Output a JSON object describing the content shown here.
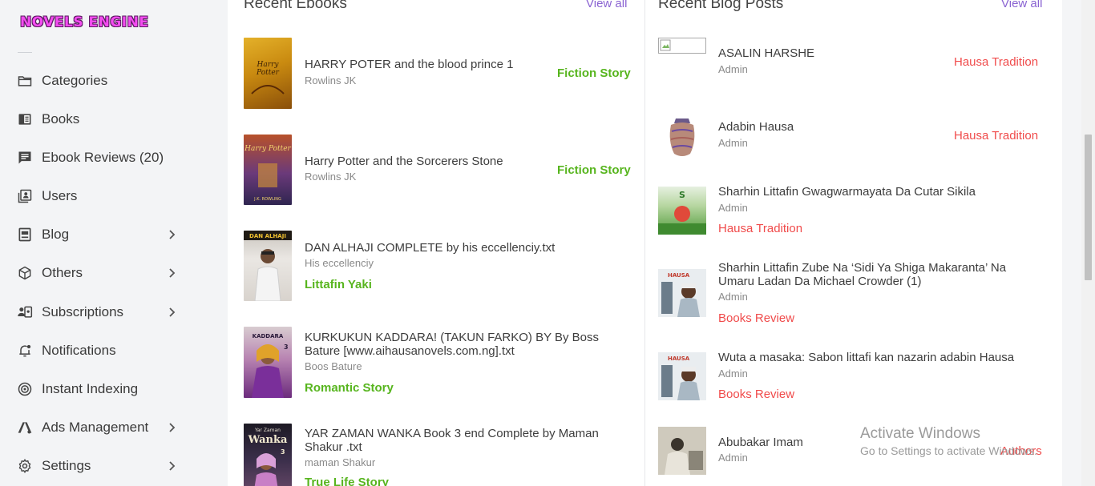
{
  "app": {
    "logo_text": "NOVELS ENGINE"
  },
  "sidebar": {
    "items": [
      {
        "label": "Categories",
        "icon": "folder-icon",
        "has_chevron": false
      },
      {
        "label": "Books",
        "icon": "book-icon",
        "has_chevron": false
      },
      {
        "label": "Ebook Reviews (20)",
        "icon": "review-icon",
        "has_chevron": false
      },
      {
        "label": "Users",
        "icon": "users-icon",
        "has_chevron": false
      },
      {
        "label": "Blog",
        "icon": "blog-icon",
        "has_chevron": true
      },
      {
        "label": "Others",
        "icon": "cube-icon",
        "has_chevron": true
      },
      {
        "label": "Subscriptions",
        "icon": "subscriptions-icon",
        "has_chevron": true
      },
      {
        "label": "Notifications",
        "icon": "bell-icon",
        "has_chevron": false
      },
      {
        "label": "Instant Indexing",
        "icon": "indexing-icon",
        "has_chevron": false
      },
      {
        "label": "Ads Management",
        "icon": "ads-icon",
        "has_chevron": true
      },
      {
        "label": "Settings",
        "icon": "gear-icon",
        "has_chevron": true
      }
    ]
  },
  "ebooks": {
    "title": "Recent Ebooks",
    "view_all": "View all",
    "items": [
      {
        "title": "HARRY POTER and the blood prince 1",
        "author": "Rowlins JK",
        "category": "Fiction Story"
      },
      {
        "title": "Harry Potter and the Sorcerers Stone",
        "author": "Rowlins JK",
        "category": "Fiction Story"
      },
      {
        "title": "DAN ALHAJI COMPLETE by his eccellenciy.txt",
        "author": "His eccellenciy",
        "category": "Littafin Yaki"
      },
      {
        "title": "KURKUKUN KADDARA! (TAKUN FARKO) BY By Boss Bature [www.aihausanovels.com.ng].txt",
        "author": "Boos Bature",
        "category": "Romantic Story"
      },
      {
        "title": "YAR ZAMAN WANKA Book 3 end Complete by Maman Shakur .txt",
        "author": "maman Shakur",
        "category": "True Life Story"
      }
    ]
  },
  "posts": {
    "title": "Recent Blog Posts",
    "view_all": "View all",
    "items": [
      {
        "title": "ASALIN HARSHE",
        "author": "Admin",
        "category": "Hausa Tradition"
      },
      {
        "title": "Adabin Hausa",
        "author": "Admin",
        "category": "Hausa Tradition"
      },
      {
        "title": "Sharhin Littafin Gwagwarmayata Da Cutar Sikila",
        "author": "Admin",
        "category": "Hausa Tradition"
      },
      {
        "title": "Sharhin Littafin Zube Na ‘Sidi Ya Shiga Makaranta’ Na Umaru Ladan Da Michael Crowder (1)",
        "author": "Admin",
        "category": "Books Review"
      },
      {
        "title": "Wuta a masaka: Sabon littafi kan nazarin adabin Hausa",
        "author": "Admin",
        "category": "Books Review"
      },
      {
        "title": "Abubakar Imam",
        "author": "Admin",
        "category": "Authors"
      }
    ]
  },
  "watermark": {
    "line1": "Activate Windows",
    "line2": "Go to Settings to activate Windows."
  },
  "colors": {
    "accent": "#8a63d2",
    "green": "#57b51e",
    "red": "#f04b4b"
  }
}
